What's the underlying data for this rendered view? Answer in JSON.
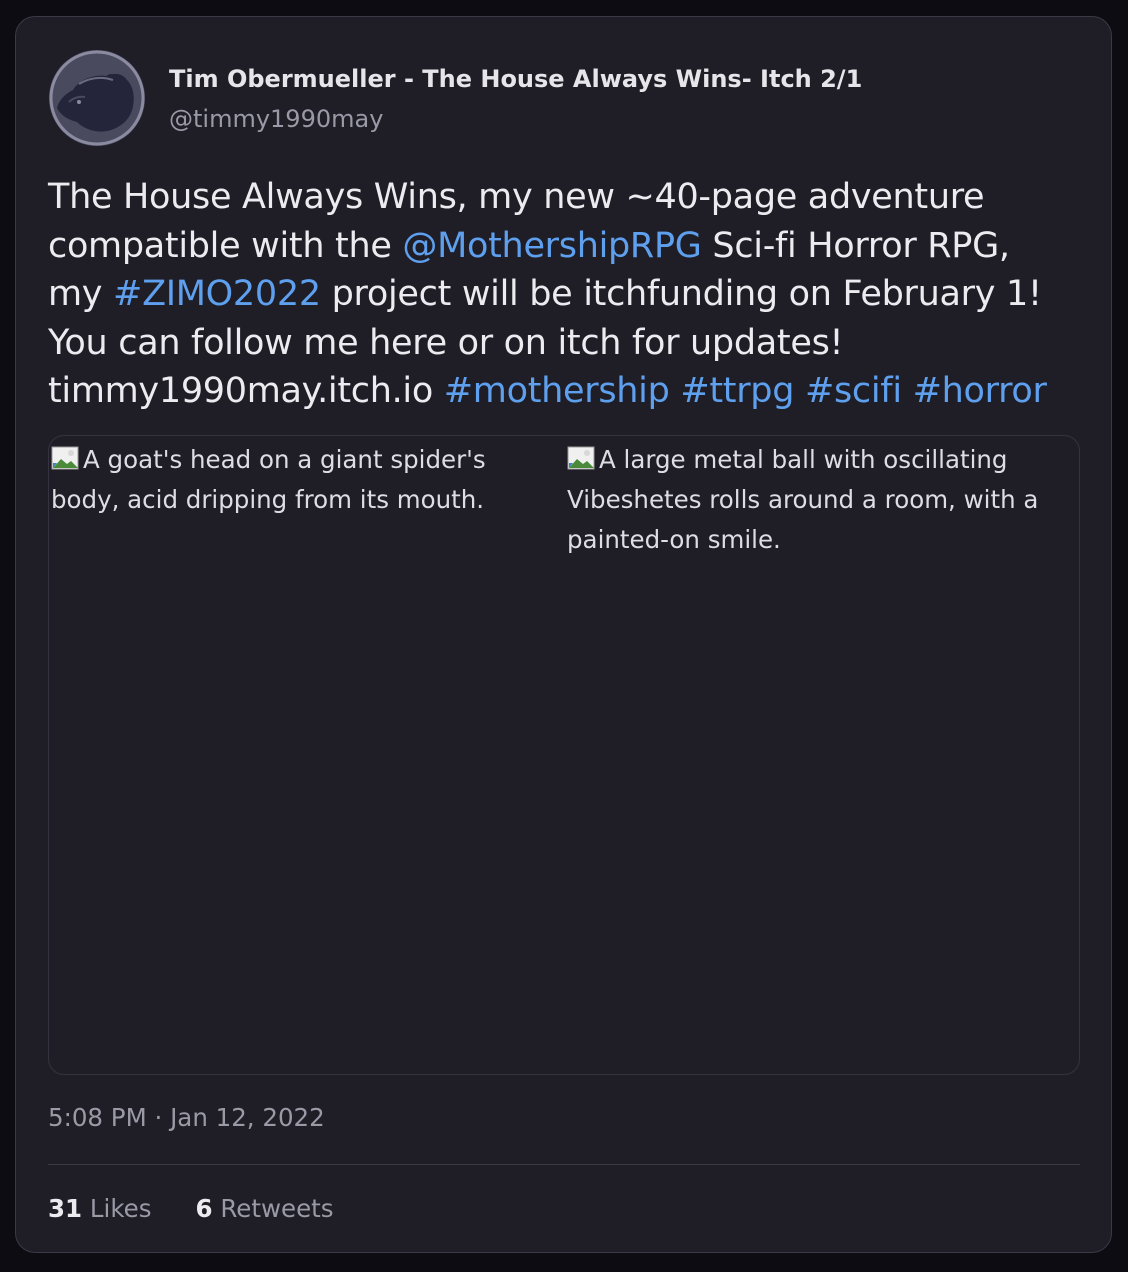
{
  "author": {
    "display_name": "Tim Obermueller - The House Always Wins- Itch 2/1",
    "handle": "@timmy1990may",
    "avatar_icon": "bear-avatar-icon"
  },
  "tweet": {
    "lines": [
      [
        {
          "text": "The House Always Wins, my new ~40-page adventure",
          "link": false
        }
      ],
      [
        {
          "text": "compatible with the ",
          "link": false
        },
        {
          "text": "@MothershipRPG",
          "link": true
        },
        {
          "text": " Sci-fi Horror RPG,",
          "link": false
        }
      ],
      [
        {
          "text": "my ",
          "link": false
        },
        {
          "text": "#ZIMO2022",
          "link": true
        },
        {
          "text": " project will be itchfunding on February 1!",
          "link": false
        }
      ],
      [
        {
          "text": "You can follow me here or on itch for updates!",
          "link": false
        }
      ],
      [
        {
          "text": "timmy1990may.itch.io ",
          "link": false
        },
        {
          "text": "#mothership",
          "link": true
        },
        {
          "text": " ",
          "link": false
        },
        {
          "text": "#ttrpg",
          "link": true
        },
        {
          "text": " ",
          "link": false
        },
        {
          "text": "#scifi",
          "link": true
        },
        {
          "text": " ",
          "link": false
        },
        {
          "text": "#horror",
          "link": true
        }
      ]
    ]
  },
  "media": [
    {
      "alt": "A goat's head on a giant spider's body, acid dripping from its mouth.",
      "icon": "broken-image-icon"
    },
    {
      "alt": "A large metal ball with oscillating Vibeshetes rolls around a room, with a painted-on smile.",
      "icon": "broken-image-icon"
    }
  ],
  "timestamp": "5:08 PM · Jan 12, 2022",
  "stats": {
    "likes_count": "31",
    "likes_label": "Likes",
    "retweets_count": "6",
    "retweets_label": "Retweets"
  },
  "colors": {
    "page_bg": "#0d0c12",
    "card_bg": "#1f1e27",
    "link": "#5ea0ee",
    "text": "#ececf0",
    "muted": "#9a99a6"
  }
}
